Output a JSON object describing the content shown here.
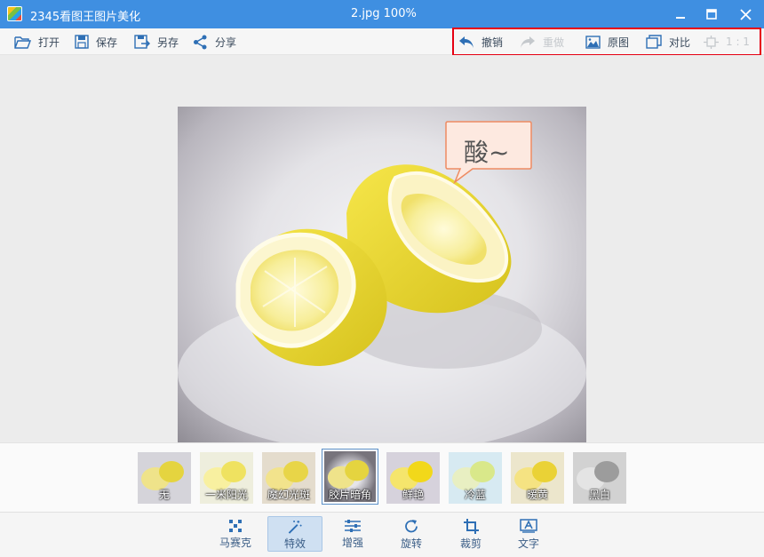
{
  "titlebar": {
    "app_title": "2345看图王图片美化",
    "file_title": "2.jpg  100%"
  },
  "toolbar": {
    "open": "打开",
    "save": "保存",
    "save_as": "另存",
    "share": "分享",
    "undo": "撤销",
    "redo": "重做",
    "original": "原图",
    "compare": "对比",
    "actual_size": "1 : 1"
  },
  "photo": {
    "bubble_text": "酸~"
  },
  "filters": [
    {
      "label": "无"
    },
    {
      "label": "一米阳光"
    },
    {
      "label": "魔幻光斑"
    },
    {
      "label": "胶片暗角"
    },
    {
      "label": "鲜艳"
    },
    {
      "label": "冷蓝"
    },
    {
      "label": "暖黄"
    },
    {
      "label": "黑白"
    }
  ],
  "selected_filter": "胶片暗角",
  "tabs": {
    "mosaic": "马赛克",
    "effects": "特效",
    "enhance": "增强",
    "rotate": "旋转",
    "crop": "裁剪",
    "text": "文字"
  },
  "active_tab": "特效",
  "colors": {
    "titlebar": "#3f8fe1",
    "highlight": "#e60012",
    "icon_blue": "#2e6fb5"
  },
  "icons": [
    "folder-open-icon",
    "save-icon",
    "save-as-icon",
    "share-icon",
    "undo-icon",
    "redo-icon",
    "picture-icon",
    "compare-icon",
    "fit-size-icon",
    "mosaic-icon",
    "magic-wand-icon",
    "sliders-icon",
    "rotate-icon",
    "crop-icon",
    "text-icon"
  ]
}
